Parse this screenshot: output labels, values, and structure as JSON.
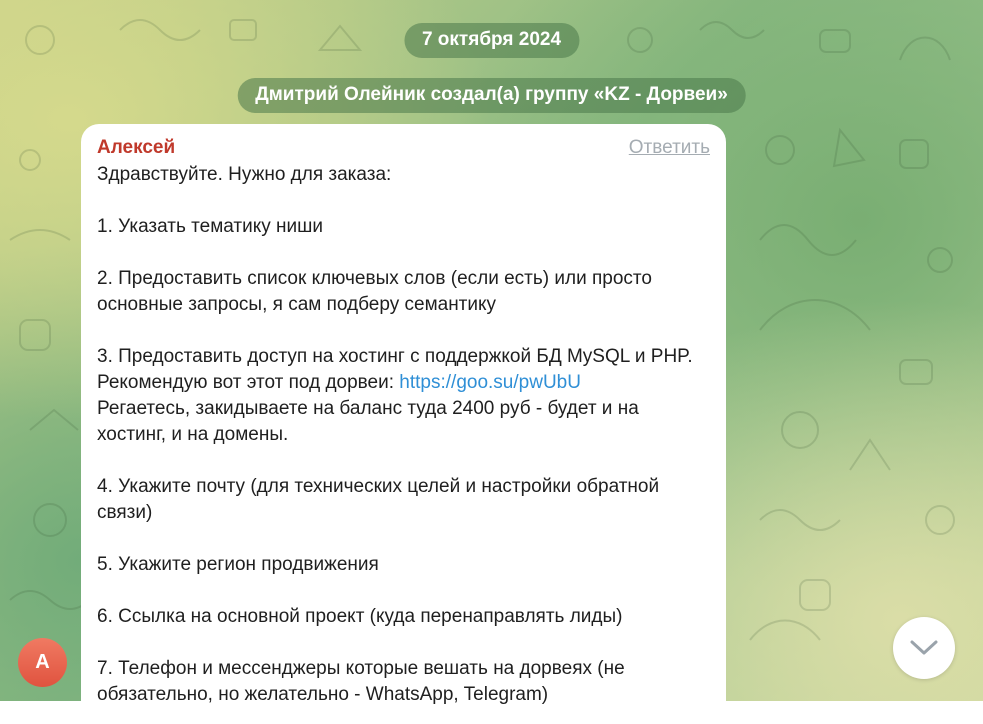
{
  "date_pill": "7 октября 2024",
  "service_message": "Дмитрий Олейник создал(а) группу «KZ - Дорвеи»",
  "message": {
    "sender": "Алексей",
    "reply_label": "Ответить",
    "greeting": "Здравствуйте. Нужно для заказа:",
    "item1": "1. Указать тематику ниши",
    "item2": "2. Предоставить список ключевых слов (если есть) или просто основные запросы, я сам подберу семантику",
    "item3_text": "3. Предоставить доступ на хостинг с поддержкой БД MySQL и PHP. Рекомендую вот этот под дорвеи: ",
    "item3_link": "https://goo.su/pwUbU",
    "item3_tail": "Регаетесь, закидываете на баланс туда 2400 руб - будет и на хостинг, и на домены.",
    "item4": "4. Укажите почту (для технических целей и настройки обратной связи)",
    "item5": "5. Укажите регион продвижения",
    "item6": "6. Ссылка на основной проект (куда перенаправлять лиды)",
    "item7": "7. Телефон и мессенджеры которые вешать на дорвеях (не обязательно, но желательно - WhatsApp, Telegram)"
  },
  "avatar_letter": "А",
  "colors": {
    "sender": "#c0392b",
    "link": "#2f8fd6",
    "avatar": "#e0533f",
    "pill_bg": "#4a784a"
  },
  "icons": {
    "scroll_down": "chevron-down-icon"
  }
}
